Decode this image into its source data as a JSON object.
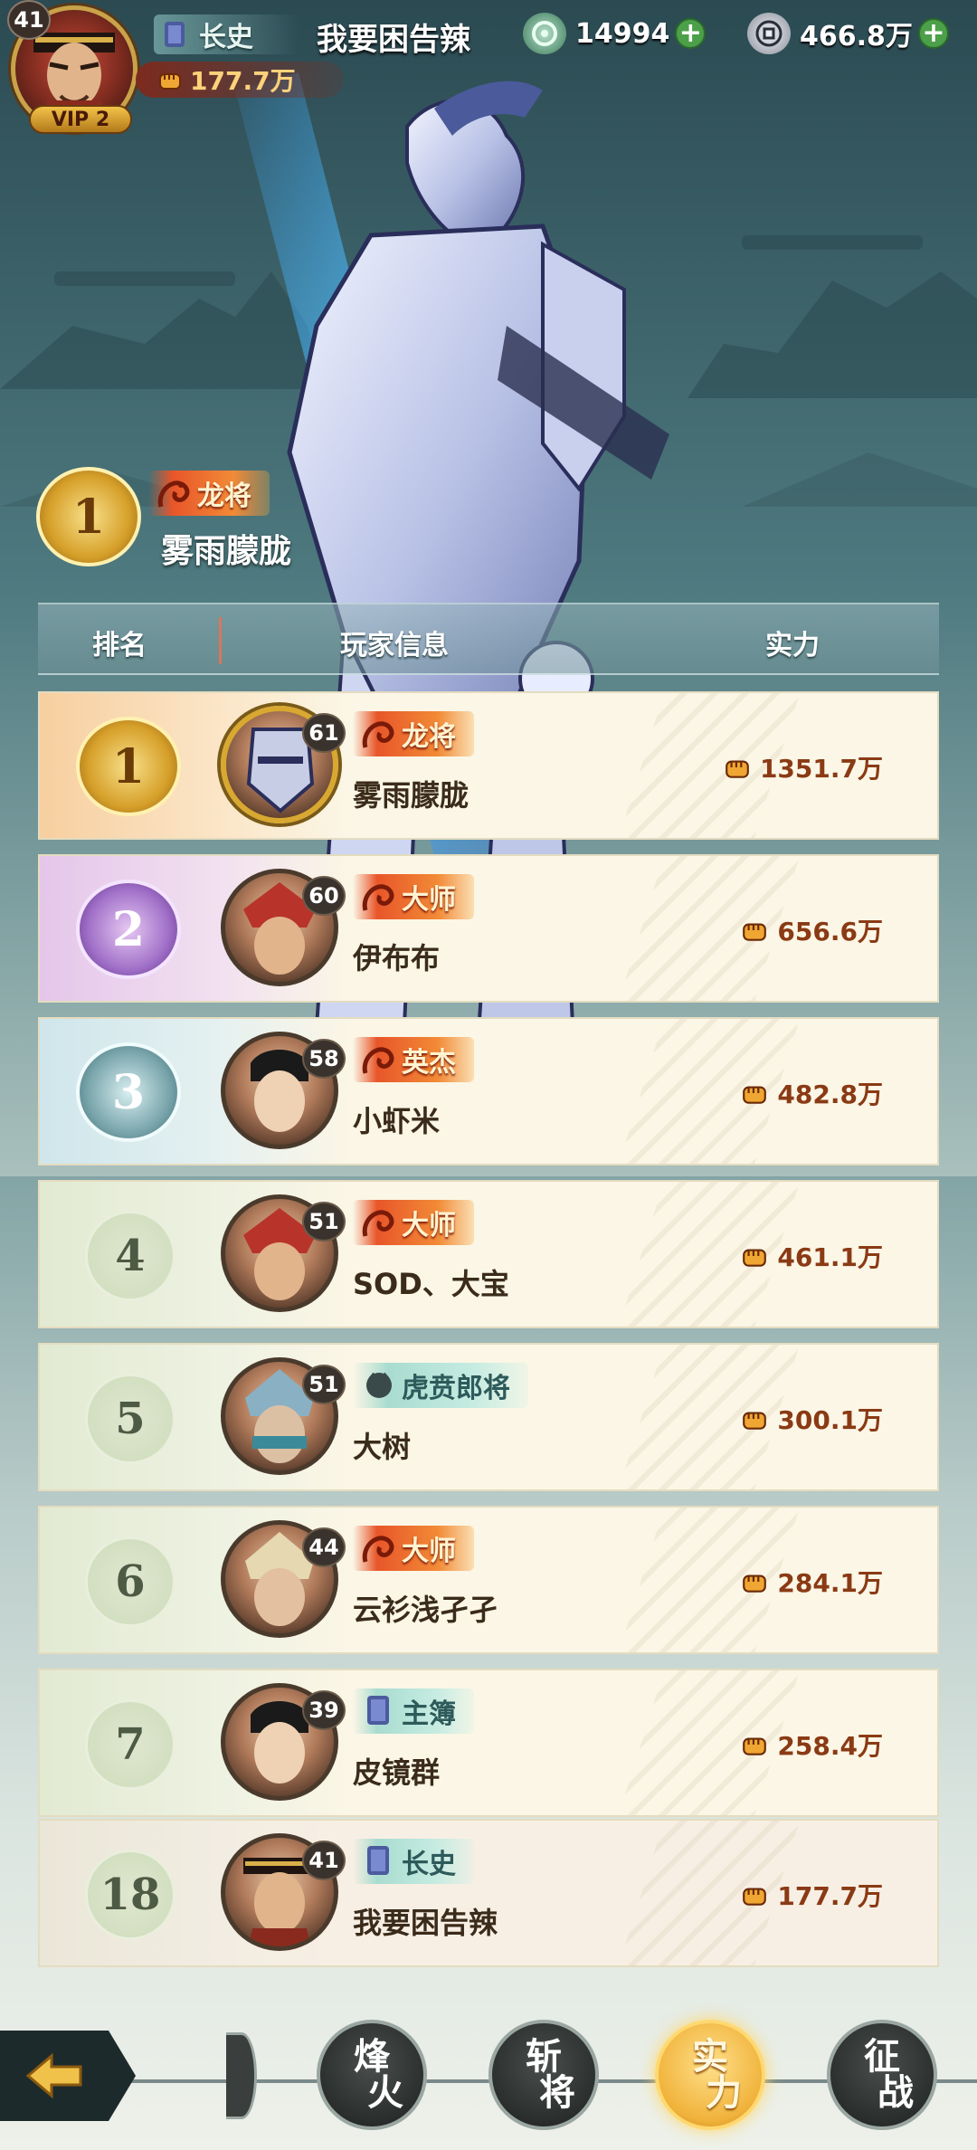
{
  "top_bar": {
    "level": "41",
    "vip": "VIP 2",
    "rank_title": "长史",
    "player_name": "我要困告辣",
    "power": "177.7万",
    "currency_1": "14994",
    "currency_2": "466.8万"
  },
  "top1": {
    "rank": "1",
    "title": "龙将",
    "name": "雾雨朦胧"
  },
  "header": {
    "rank": "排名",
    "player_info": "玩家信息",
    "power": "实力"
  },
  "rows": [
    {
      "rank": "1",
      "level": "61",
      "title": "龙将",
      "title_style": "fire",
      "name": "雾雨朦胧",
      "power": "1351.7万"
    },
    {
      "rank": "2",
      "level": "60",
      "title": "大师",
      "title_style": "fire",
      "name": "伊布布",
      "power": "656.6万"
    },
    {
      "rank": "3",
      "level": "58",
      "title": "英杰",
      "title_style": "fire",
      "name": "小虾米",
      "power": "482.8万"
    },
    {
      "rank": "4",
      "level": "51",
      "title": "大师",
      "title_style": "fire",
      "name": "SOD、大宝",
      "power": "461.1万"
    },
    {
      "rank": "5",
      "level": "51",
      "title": "虎贲郎将",
      "title_style": "teal",
      "name": "大树",
      "power": "300.1万"
    },
    {
      "rank": "6",
      "level": "44",
      "title": "大师",
      "title_style": "fire",
      "name": "云衫浅孑孑",
      "power": "284.1万"
    },
    {
      "rank": "7",
      "level": "39",
      "title": "主簿",
      "title_style": "teal",
      "name": "皮镜群",
      "power": "258.4万"
    }
  ],
  "self_row": {
    "rank": "18",
    "level": "41",
    "title": "长史",
    "name": "我要困告辣",
    "power": "177.7万"
  },
  "nav": {
    "btn1": [
      "烽",
      "火"
    ],
    "btn2": [
      "斩",
      "将"
    ],
    "btn3": [
      "实",
      "力"
    ],
    "btn4": [
      "征",
      "战"
    ],
    "active": "btn3"
  },
  "colors": {
    "fire_title": "#e8562a",
    "teal_title": "#a9dcd0",
    "row_bg": "#fbf6e6",
    "power_text": "#8a3a14",
    "active_nav": "#f0b23a"
  }
}
